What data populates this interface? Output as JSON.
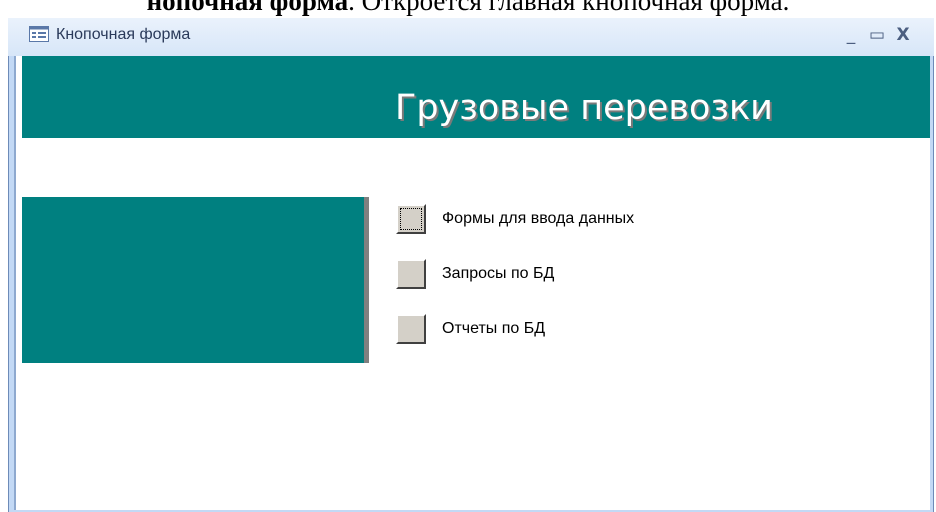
{
  "document": {
    "caption_bold": "нопочная форма",
    "caption_rest": "",
    "caption_tail": ". Откроется главная кнопочная форма."
  },
  "window": {
    "title": "Кнопочная форма",
    "controls": {
      "minimize": "_",
      "maximize": "▭",
      "close": "X"
    },
    "icon": "form-icon"
  },
  "form": {
    "header_title": "Грузовые перевозки",
    "accent_color": "#008080",
    "items": [
      {
        "label": "Формы для ввода данных",
        "focused": true
      },
      {
        "label": "Запросы по БД",
        "focused": false
      },
      {
        "label": "Отчеты по БД",
        "focused": false
      }
    ]
  }
}
